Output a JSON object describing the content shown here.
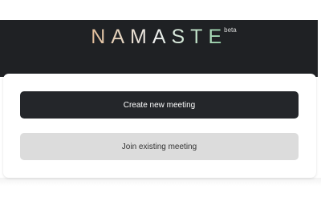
{
  "brand": {
    "name": "NAMASTE",
    "badge": "beta"
  },
  "actions": {
    "create_label": "Create new meeting",
    "join_label": "Join existing meeting"
  },
  "colors": {
    "header_bg": "#1f2124",
    "primary_button": "#24262a",
    "secondary_button": "#dcdcdc"
  }
}
